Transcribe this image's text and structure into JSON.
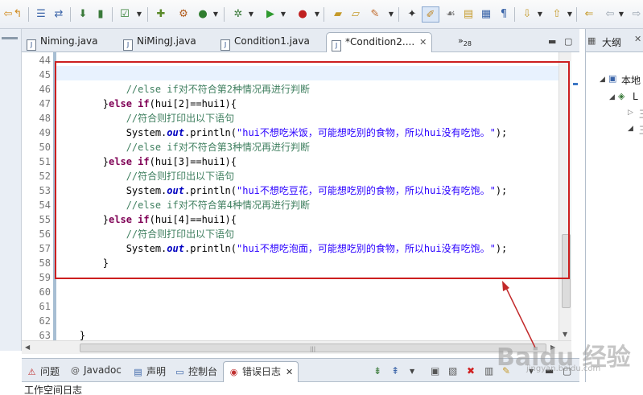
{
  "toolbar": {
    "icons": [
      "back-icon",
      "run-last-icon",
      "list-icon",
      "compare-icon",
      "save-icon",
      "battery-icon",
      "checkbox-icon",
      "open-type-icon",
      "debug-config-icon",
      "coverage-icon",
      "settings-icon",
      "run-icon",
      "external-tools-icon",
      "open-folder-icon",
      "open-file-icon",
      "search-icon",
      "pin-icon",
      "highlight-pen-icon",
      "mark-icon",
      "view-icon",
      "page-icon",
      "paragraph-icon",
      "next-annotation-icon",
      "previous-annotation-icon",
      "last-edit-icon",
      "back-nav-icon",
      "forward-nav-icon"
    ]
  },
  "editor_tabs": [
    {
      "label": "Niming.java",
      "active": false
    },
    {
      "label": "NiMingJ.java",
      "active": false
    },
    {
      "label": "Condition1.java",
      "active": false
    },
    {
      "label": "*Condition2....",
      "active": true
    }
  ],
  "overflow_tabs": {
    "symbol": "»",
    "count": "28"
  },
  "outline": {
    "title": "大纲",
    "items": [
      "本地",
      "L",
      "王",
      "王"
    ]
  },
  "editor": {
    "line_numbers": [
      "44",
      "45",
      "46",
      "47",
      "48",
      "49",
      "50",
      "51",
      "52",
      "53",
      "54",
      "55",
      "56",
      "57",
      "58",
      "59",
      "60",
      "61",
      "62",
      "63"
    ],
    "lines": [
      [],
      [],
      [
        {
          "t": "cm",
          "v": "            //else if对不符合第2种情况再进行判断"
        }
      ],
      [
        {
          "t": "txt",
          "v": "        }"
        },
        {
          "t": "kw",
          "v": "else"
        },
        {
          "t": "txt",
          "v": " "
        },
        {
          "t": "kw",
          "v": "if"
        },
        {
          "t": "txt",
          "v": "(hui[2]==hui1){"
        }
      ],
      [
        {
          "t": "cm",
          "v": "            //符合则打印出以下语句"
        }
      ],
      [
        {
          "t": "txt",
          "v": "            System."
        },
        {
          "t": "fld",
          "v": "out"
        },
        {
          "t": "txt",
          "v": ".println("
        },
        {
          "t": "str",
          "v": "\"hui不想吃米饭，可能想吃别的食物，所以hui没有吃饱。\""
        },
        {
          "t": "txt",
          "v": ");"
        }
      ],
      [
        {
          "t": "cm",
          "v": "            //else if对不符合第3种情况再进行判断"
        }
      ],
      [
        {
          "t": "txt",
          "v": "        }"
        },
        {
          "t": "kw",
          "v": "else"
        },
        {
          "t": "txt",
          "v": " "
        },
        {
          "t": "kw",
          "v": "if"
        },
        {
          "t": "txt",
          "v": "(hui[3]==hui1){"
        }
      ],
      [
        {
          "t": "cm",
          "v": "            //符合则打印出以下语句"
        }
      ],
      [
        {
          "t": "txt",
          "v": "            System."
        },
        {
          "t": "fld",
          "v": "out"
        },
        {
          "t": "txt",
          "v": ".println("
        },
        {
          "t": "str",
          "v": "\"hui不想吃豆花，可能想吃别的食物，所以hui没有吃饱。\""
        },
        {
          "t": "txt",
          "v": ");"
        }
      ],
      [
        {
          "t": "cm",
          "v": "            //else if对不符合第4种情况再进行判断"
        }
      ],
      [
        {
          "t": "txt",
          "v": "        }"
        },
        {
          "t": "kw",
          "v": "else"
        },
        {
          "t": "txt",
          "v": " "
        },
        {
          "t": "kw",
          "v": "if"
        },
        {
          "t": "txt",
          "v": "(hui[4]==hui1){"
        }
      ],
      [
        {
          "t": "cm",
          "v": "            //符合则打印出以下语句"
        }
      ],
      [
        {
          "t": "txt",
          "v": "            System."
        },
        {
          "t": "fld",
          "v": "out"
        },
        {
          "t": "txt",
          "v": ".println("
        },
        {
          "t": "str",
          "v": "\"hui不想吃泡面，可能想吃别的食物，所以hui没有吃饱。\""
        },
        {
          "t": "txt",
          "v": ");"
        }
      ],
      [
        {
          "t": "txt",
          "v": "        }"
        }
      ],
      [],
      [],
      [],
      [],
      [
        {
          "t": "txt",
          "v": "    }"
        }
      ]
    ]
  },
  "bottom_panel": {
    "tabs": [
      {
        "icon": "problems-icon",
        "label": "问题",
        "active": false
      },
      {
        "icon": "javadoc-icon",
        "label": "Javadoc",
        "active": false
      },
      {
        "icon": "declaration-icon",
        "label": "声明",
        "active": false
      },
      {
        "icon": "console-icon",
        "label": "控制台",
        "active": false
      },
      {
        "icon": "error-log-icon",
        "label": "错误日志",
        "active": true
      }
    ],
    "content_label": "工作空间日志"
  },
  "colors": {
    "highlight_box": "#cc1f1f",
    "comment": "#3f7f5f",
    "keyword": "#7f0055",
    "string": "#2a00ff"
  },
  "watermark": {
    "text": "Baidu 经验",
    "sub": "jingyan.baidu.com"
  }
}
